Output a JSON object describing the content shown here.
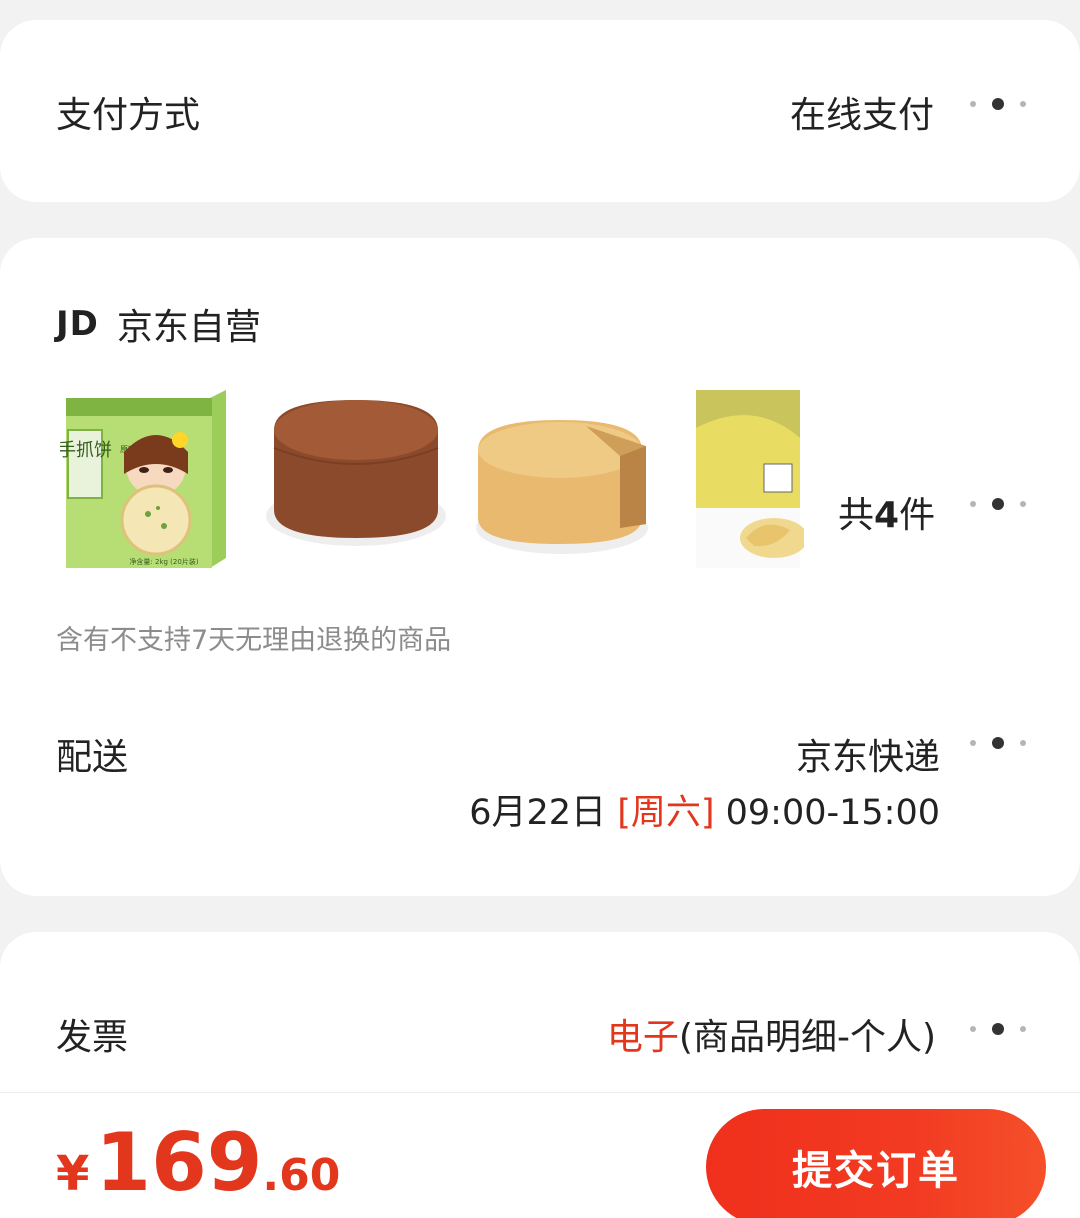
{
  "payment": {
    "label": "支付方式",
    "value": "在线支付"
  },
  "shop": {
    "logo": "JD",
    "name": "京东自营",
    "products": [
      {
        "name": "手抓饼",
        "box_label": "手抓饼",
        "sub_label": "原味",
        "weight": "净含量: 2kg (20片装)"
      },
      {
        "name": "chocolate sponge cake"
      },
      {
        "name": "plain sponge cake"
      },
      {
        "name": "pastry sheet pack"
      }
    ],
    "count_prefix": "共",
    "count_number": "4",
    "count_suffix": "件",
    "notice": "含有不支持7天无理由退换的商品"
  },
  "delivery": {
    "label": "配送",
    "carrier": "京东快递",
    "date": "6月22日",
    "weekday": "[周六]",
    "time": "09:00-15:00"
  },
  "invoice": {
    "label": "发票",
    "type": "电子",
    "detail": "(商品明细-个人)"
  },
  "footer": {
    "currency": "¥",
    "price_int": "169",
    "price_dec": ".60",
    "submit_label": "提交订单"
  },
  "colors": {
    "accent": "#e2361d",
    "background": "#f2f2f2",
    "card": "#ffffff"
  }
}
